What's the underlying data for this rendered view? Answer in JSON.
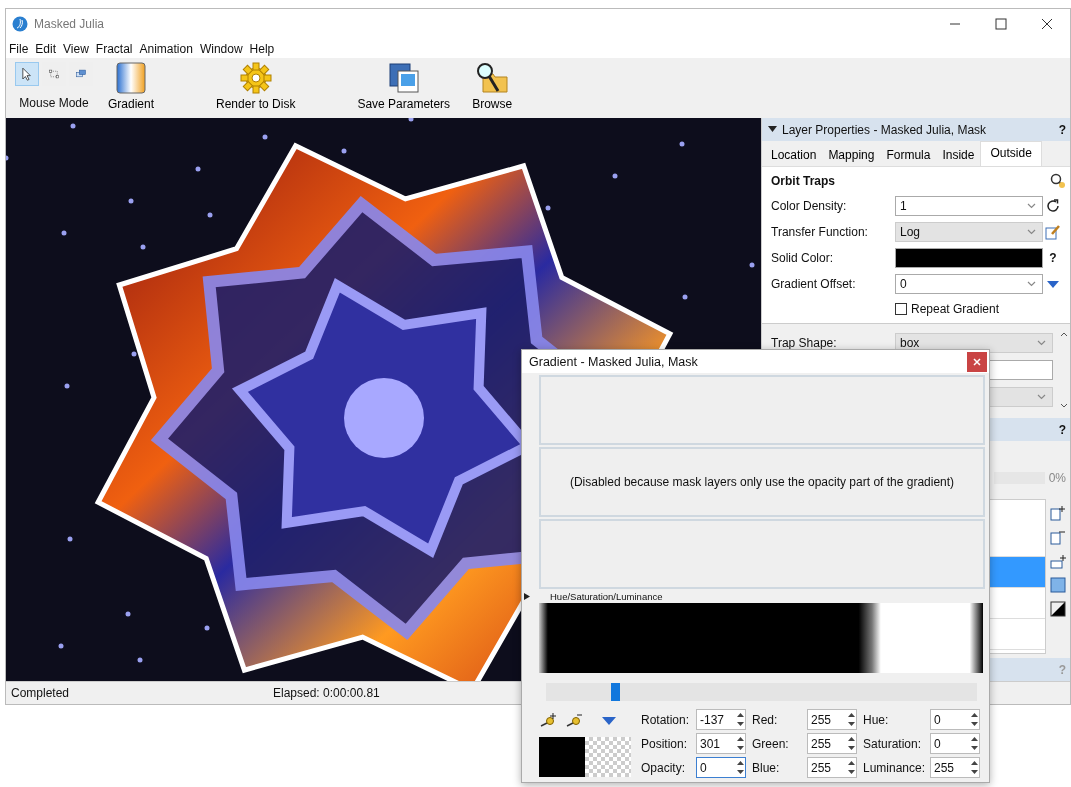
{
  "window": {
    "title": "Masked Julia"
  },
  "menu": [
    "File",
    "Edit",
    "View",
    "Fractal",
    "Animation",
    "Window",
    "Help"
  ],
  "mouse_modes": {
    "label": "Mouse Mode",
    "buttons": [
      {
        "kind": "pointer",
        "selected": true
      },
      {
        "kind": "box",
        "selected": false
      },
      {
        "kind": "windows",
        "selected": false
      }
    ]
  },
  "toolbar": [
    {
      "kind": "gradient",
      "label": "Gradient"
    },
    {
      "kind": "gear",
      "label": "Render to Disk"
    },
    {
      "kind": "save",
      "label": "Save Parameters"
    },
    {
      "kind": "browse",
      "label": "Browse"
    }
  ],
  "layer_properties": {
    "title": "Layer Properties - Masked Julia, Mask",
    "expanded": true,
    "help": "?",
    "tabs": [
      {
        "label": "Location",
        "selected": false
      },
      {
        "label": "Mapping",
        "selected": false
      },
      {
        "label": "Formula",
        "selected": false
      },
      {
        "label": "Inside",
        "selected": false
      },
      {
        "label": "Outside",
        "selected": true
      }
    ],
    "section": "Orbit Traps",
    "fields": [
      {
        "kind": "dropdown",
        "label": "Color Density:",
        "value": "1"
      },
      {
        "kind": "combo",
        "label": "Transfer Function:",
        "value": "Log"
      },
      {
        "kind": "color",
        "label": "Solid Color:",
        "color": "#000000",
        "help": "?"
      },
      {
        "kind": "dropdown",
        "label": "Gradient Offset:",
        "value": "0"
      }
    ],
    "repeat_gradient": {
      "label": "Repeat Gradient",
      "checked": false
    },
    "trap_fields": [
      {
        "kind": "combo",
        "label": "Trap Shape:",
        "value": "box"
      },
      {
        "kind": "text"
      },
      {
        "kind": "combo"
      }
    ]
  },
  "layers_panel": {
    "help": "?",
    "progress": {
      "level": 0,
      "reading": "0%"
    },
    "rows": [
      {
        "selected": false
      },
      {
        "selected": true
      },
      {
        "selected": false
      },
      {
        "selected": false
      }
    ]
  },
  "bottom_panel": {
    "help": "?"
  },
  "status_bar": {
    "status": "Completed",
    "elapsed": "Elapsed: 0:00:00.81"
  },
  "gradient_dialog": {
    "title": "Gradient - Masked Julia, Mask",
    "message": "(Disabled because mask layers only use the opacity part of the gradient)",
    "hsl_label": "Hue/Saturation/Luminance",
    "hsl_expanded": false,
    "slider": {
      "level": 0.16
    },
    "field_columns": [
      [
        {
          "label": "Rotation:",
          "value": "-137",
          "focused": false
        },
        {
          "label": "Position:",
          "value": "301",
          "focused": false
        },
        {
          "label": "Opacity:",
          "value": "0",
          "focused": true
        }
      ],
      [
        {
          "label": "Red:",
          "value": "255",
          "focused": false
        },
        {
          "label": "Green:",
          "value": "255",
          "focused": false
        },
        {
          "label": "Blue:",
          "value": "255",
          "focused": false
        }
      ],
      [
        {
          "label": "Hue:",
          "value": "0",
          "focused": false
        },
        {
          "label": "Saturation:",
          "value": "0",
          "focused": false
        },
        {
          "label": "Luminance:",
          "value": "255",
          "focused": false
        }
      ]
    ]
  }
}
